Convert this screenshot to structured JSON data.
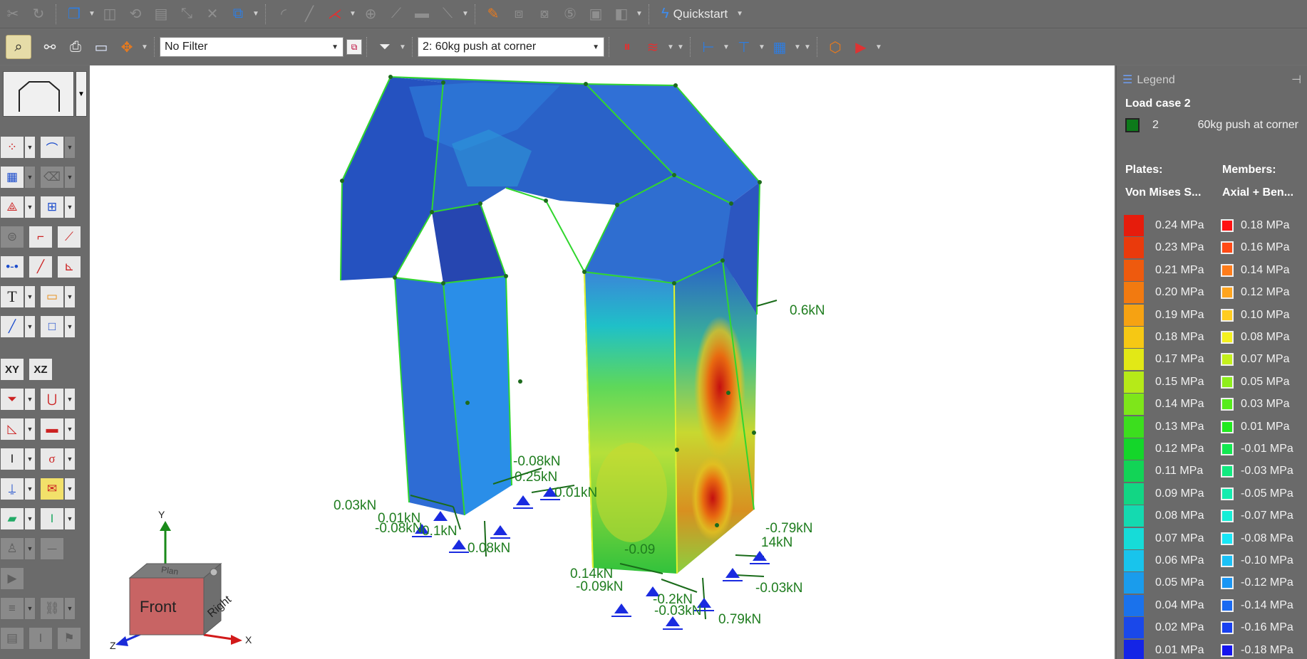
{
  "toolbar1": {
    "quickstart_label": "Quickstart"
  },
  "toolbar2": {
    "filter_value": "No Filter",
    "loadcase_value": "2: 60kg push at corner"
  },
  "legend": {
    "header": "Legend",
    "load_case_title": "Load case 2",
    "case_number": "2",
    "case_name": "60kg push at corner",
    "case_color": "#0d7a1a",
    "plates_heading": "Plates:",
    "plates_type": "Von Mises S...",
    "members_heading": "Members:",
    "members_type": "Axial + Ben...",
    "plates_scale": [
      {
        "label": "0.24 MPa",
        "color": "#e61c0c"
      },
      {
        "label": "0.23 MPa",
        "color": "#ea3a0c"
      },
      {
        "label": "0.21 MPa",
        "color": "#ee5a0e"
      },
      {
        "label": "0.20 MPa",
        "color": "#f27a10"
      },
      {
        "label": "0.19 MPa",
        "color": "#f6a212"
      },
      {
        "label": "0.18 MPa",
        "color": "#f6c814"
      },
      {
        "label": "0.17 MPa",
        "color": "#e2e816"
      },
      {
        "label": "0.15 MPa",
        "color": "#b6ea18"
      },
      {
        "label": "0.14 MPa",
        "color": "#7ee61a"
      },
      {
        "label": "0.13 MPa",
        "color": "#3cde1e"
      },
      {
        "label": "0.12 MPa",
        "color": "#14d62a"
      },
      {
        "label": "0.11 MPa",
        "color": "#12d456"
      },
      {
        "label": "0.09 MPa",
        "color": "#12d684"
      },
      {
        "label": "0.08 MPa",
        "color": "#14dab0"
      },
      {
        "label": "0.07 MPa",
        "color": "#16dcd8"
      },
      {
        "label": "0.06 MPa",
        "color": "#18c4ec"
      },
      {
        "label": "0.05 MPa",
        "color": "#1a9cec"
      },
      {
        "label": "0.04 MPa",
        "color": "#1a72ec"
      },
      {
        "label": "0.02 MPa",
        "color": "#1a48ea"
      },
      {
        "label": "0.01 MPa",
        "color": "#1424e6"
      }
    ],
    "members_scale": [
      {
        "label": "0.18 MPa",
        "color": "#ff1212"
      },
      {
        "label": "0.16 MPa",
        "color": "#ff4a16"
      },
      {
        "label": "0.14 MPa",
        "color": "#ff7c1a"
      },
      {
        "label": "0.12 MPa",
        "color": "#ffa41e"
      },
      {
        "label": "0.10 MPa",
        "color": "#ffcc20"
      },
      {
        "label": "0.08 MPa",
        "color": "#f4f01e"
      },
      {
        "label": "0.07 MPa",
        "color": "#c4f01c"
      },
      {
        "label": "0.05 MPa",
        "color": "#8eee1c"
      },
      {
        "label": "0.03 MPa",
        "color": "#56ec1c"
      },
      {
        "label": "0.01 MPa",
        "color": "#22ea20"
      },
      {
        "label": "-0.01 MPa",
        "color": "#12e850"
      },
      {
        "label": "-0.03 MPa",
        "color": "#12ea80"
      },
      {
        "label": "-0.05 MPa",
        "color": "#14ecae"
      },
      {
        "label": "-0.07 MPa",
        "color": "#16eed6"
      },
      {
        "label": "-0.08 MPa",
        "color": "#18e6f6"
      },
      {
        "label": "-0.10 MPa",
        "color": "#1ac0f6"
      },
      {
        "label": "-0.12 MPa",
        "color": "#1a96f4"
      },
      {
        "label": "-0.14 MPa",
        "color": "#1a6af2"
      },
      {
        "label": "-0.16 MPa",
        "color": "#1840f0"
      },
      {
        "label": "-0.18 MPa",
        "color": "#1414ee"
      }
    ]
  },
  "left_palette": {
    "xy_label": "XY",
    "xz_label": "XZ",
    "text_label": "T"
  },
  "view_cube": {
    "front_label": "Front",
    "right_label": "Right",
    "top_label": "Plan",
    "axis_x": "X",
    "axis_y": "Y",
    "axis_z": "Z"
  },
  "force_labels": {
    "top_right": "0.6kN",
    "left_a": "0.03kN",
    "left_b": "-0.08kN",
    "left_c": "0.01kN",
    "left_d": "0.08kN",
    "left_e": "0.1kN",
    "left_f": "0.01kN",
    "left_g": "-0.08kN",
    "left_h": "0.25kN",
    "right_a": "-0.79kN",
    "right_b": "14kN",
    "right_c": "-0.03kN",
    "right_d": "0.79kN",
    "right_e": "0.14kN",
    "right_f": "-0.09kN",
    "right_g": "-0.09",
    "right_h": "-0.2kN",
    "right_i": "-0.03kN"
  }
}
